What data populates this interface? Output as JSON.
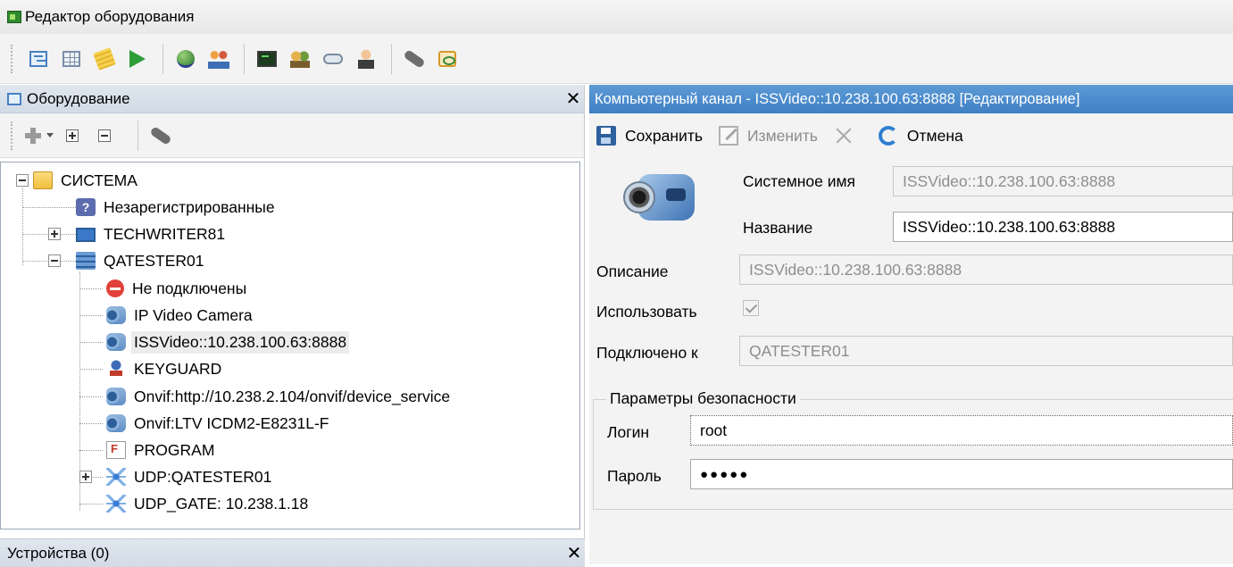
{
  "window": {
    "title": "Редактор оборудования"
  },
  "toolbar": {
    "icons": [
      "tree-icon",
      "grid-icon",
      "notes-icon",
      "flag-icon",
      "globe-icon",
      "users-icon",
      "monitor-icon",
      "group-icon",
      "drive-icon",
      "person-icon",
      "pen-icon",
      "card-icon"
    ]
  },
  "equipment_panel": {
    "title": "Оборудование",
    "close": "✕",
    "tree": {
      "root": "СИСТЕМА",
      "unregistered": "Незарегистрированные",
      "techwriter": "TECHWRITER81",
      "qatester": "QATESTER01",
      "not_connected": "Не подключены",
      "ip_camera": "IP Video Camera",
      "issvideo": "ISSVideo::10.238.100.63:8888",
      "keyguard": "KEYGUARD",
      "onvif_http": "Onvif:http://10.238.2.104/onvif/device_service",
      "onvif_ltv": "Onvif:LTV ICDM2-E8231L-F",
      "program": "PROGRAM",
      "udp_qatester": "UDP:QATESTER01",
      "udp_gate": "UDP_GATE: 10.238.1.18"
    }
  },
  "devices_panel": {
    "title": "Устройства (0)",
    "close": "✕"
  },
  "editor": {
    "header": "Компьютерный канал - ISSVideo::10.238.100.63:8888 [Редактирование]",
    "actions": {
      "save": "Сохранить",
      "edit": "Изменить",
      "cancel": "Отмена"
    },
    "fields": {
      "system_name_label": "Системное имя",
      "system_name_value": "ISSVideo::10.238.100.63:8888",
      "name_label": "Название",
      "name_value": "ISSVideo::10.238.100.63:8888",
      "description_label": "Описание",
      "description_value": "ISSVideo::10.238.100.63:8888",
      "use_label": "Использовать",
      "use_checked": true,
      "connected_label": "Подключено к",
      "connected_value": "QATESTER01"
    },
    "security": {
      "title": "Параметры безопасности",
      "login_label": "Логин",
      "login_value": "root",
      "password_label": "Пароль",
      "password_value": "●●●●●"
    }
  }
}
